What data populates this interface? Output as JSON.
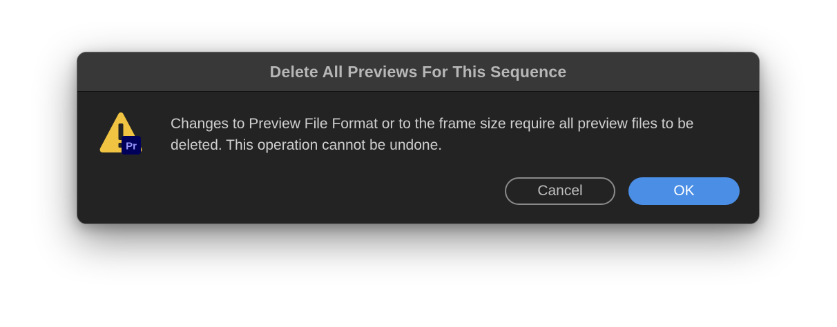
{
  "dialog": {
    "title": "Delete All Previews For This Sequence",
    "message": "Changes to Preview File Format or to the frame size require all preview files to be deleted. This operation cannot be undone.",
    "badge_text": "Pr",
    "cancel_label": "Cancel",
    "ok_label": "OK"
  },
  "colors": {
    "warning": "#f0c442",
    "badge_bg": "#00005b",
    "badge_text": "#9999ff",
    "ok_button": "#4a8ee6",
    "dialog_bg": "#232323",
    "titlebar_bg": "#383838"
  },
  "icons": [
    "warning-icon",
    "premiere-pro-badge-icon"
  ]
}
